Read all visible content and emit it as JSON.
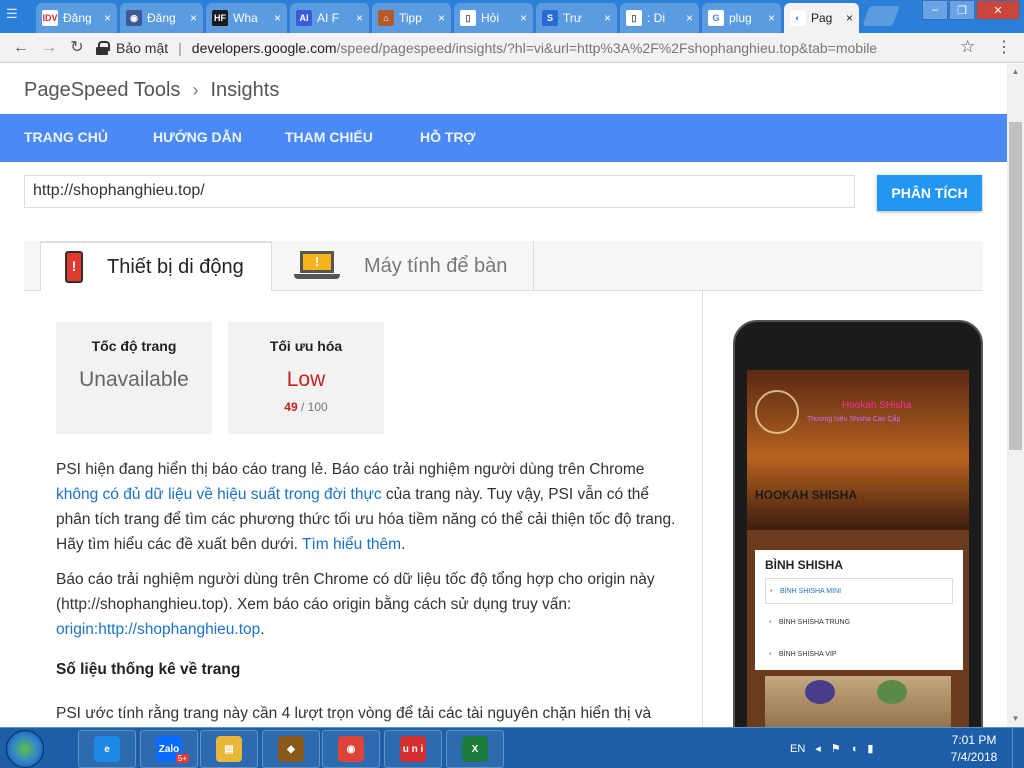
{
  "browser": {
    "tabs": [
      {
        "title": "Đăng",
        "fav_text": "IDV",
        "fav_color": "#ffffff",
        "fav_fg": "#d32f2f"
      },
      {
        "title": "Đăng",
        "fav_text": "◉",
        "fav_color": "#3d5a98",
        "fav_fg": "#ffffff"
      },
      {
        "title": "Wha",
        "fav_text": "HF",
        "fav_color": "#1b1b1b",
        "fav_fg": "#ffffff"
      },
      {
        "title": "AI F",
        "fav_text": "AI",
        "fav_color": "#3b5bdb",
        "fav_fg": "#ffffff"
      },
      {
        "title": "Tipp",
        "fav_text": "⌂",
        "fav_color": "#b35a2a",
        "fav_fg": "#ffffff"
      },
      {
        "title": "Hỏi",
        "fav_text": "▯",
        "fav_color": "#ffffff",
        "fav_fg": "#555555"
      },
      {
        "title": "Trư",
        "fav_text": "S",
        "fav_color": "#2a6ad8",
        "fav_fg": "#ffffff"
      },
      {
        "title": ": Di",
        "fav_text": "▯",
        "fav_color": "#ffffff",
        "fav_fg": "#555555"
      },
      {
        "title": "plug",
        "fav_text": "G",
        "fav_color": "#ffffff",
        "fav_fg": "#4285f4"
      },
      {
        "title": "Pag",
        "fav_text": "◐",
        "fav_color": "#ffffff",
        "fav_fg": "#4285f4",
        "active": true
      }
    ],
    "tab_close_glyph": "×",
    "window": {
      "minimize": "–",
      "restore": "❐",
      "close": "✕"
    },
    "toolbar": {
      "back": "←",
      "forward": "→",
      "reload": "↻",
      "secure_label": "Bảo mật",
      "url_host": "developers.google.com",
      "url_path": "/speed/pagespeed/insights/?hl=vi&url=http%3A%2F%2Fshophanghieu.top&tab=mobile",
      "bookmark_star": "☆",
      "menu_icon": "⋮"
    }
  },
  "page": {
    "breadcrumb": [
      "PageSpeed Tools",
      "Insights"
    ],
    "nav": [
      "TRANG CHỦ",
      "HƯỚNG DẪN",
      "THAM CHIẾU",
      "HỖ TRỢ"
    ],
    "url_value": "http://shophanghieu.top/",
    "analyze_label": "PHÂN TÍCH",
    "device_tabs": {
      "mobile": "Thiết bị di động",
      "desktop": "Máy tính để bàn"
    },
    "cards": [
      {
        "label": "Tốc độ trang",
        "value": "Unavailable",
        "status": "gray"
      },
      {
        "label": "Tối ưu hóa",
        "value": "Low",
        "score": "49",
        "score_max": "/ 100",
        "status": "red"
      }
    ],
    "p1": {
      "a": "PSI hiện đang hiển thị báo cáo trang lẻ. Báo cáo trải nghiệm người dùng trên Chrome ",
      "link": "không có đủ dữ liệu về hiệu suất trong đời thực",
      "b": " của trang này. Tuy vậy, PSI vẫn có thể phân tích trang để tìm các phương thức tối ưu hóa tiềm năng có thể cải thiện tốc độ trang. Hãy tìm hiểu các đề xuất bên dưới. ",
      "link2": "Tìm hiểu thêm",
      "c": "."
    },
    "p2": {
      "a": "Báo cáo trải nghiệm người dùng trên Chrome có dữ liệu tốc độ tổng hợp cho origin này (http://shophanghieu.top). Xem báo cáo origin bằng cách sử dụng truy vấn: ",
      "link": "origin:http://shophanghieu.top",
      "b": "."
    },
    "section_heading": "Số liệu thống kê về trang",
    "p3": "PSI ước tính rằng trang này cần 4 lượt trọn vòng để tải các tài nguyên chặn hiển thị và",
    "preview": {
      "hero_title": "Hookah SHisha",
      "hero_sub": "Thương hiệu Shisha Cao Cấp",
      "hero_big": "HOOKAH SHISHA",
      "menu_heading": "BÌNH SHISHA",
      "menu_items": [
        "BÌNH SHISHA MINI",
        "BÌNH SHISHA TRUNG",
        "BÌNH SHISHA VIP"
      ]
    }
  },
  "taskbar": {
    "apps": [
      {
        "name": "internet-explorer",
        "text": "e",
        "color": "#1e88e5"
      },
      {
        "name": "zalo",
        "text": "Zalo",
        "color": "#0a6cff",
        "badge": "5+"
      },
      {
        "name": "file-explorer",
        "text": "▤",
        "color": "#e9b73a"
      },
      {
        "name": "game",
        "text": "◆",
        "color": "#8a5a1a"
      },
      {
        "name": "chrome",
        "text": "◉",
        "color": "#db4437"
      },
      {
        "name": "unikey",
        "text": "u n i",
        "color": "#d32f2f"
      },
      {
        "name": "excel",
        "text": "X",
        "color": "#1e7b3e"
      }
    ],
    "lang": "EN",
    "time": "7:01 PM",
    "date": "7/4/2018"
  },
  "colors": {
    "nav_blue": "#4b8af4",
    "analyze_blue": "#2196f3",
    "low_red": "#c5221f",
    "link": "#1a73c8"
  }
}
